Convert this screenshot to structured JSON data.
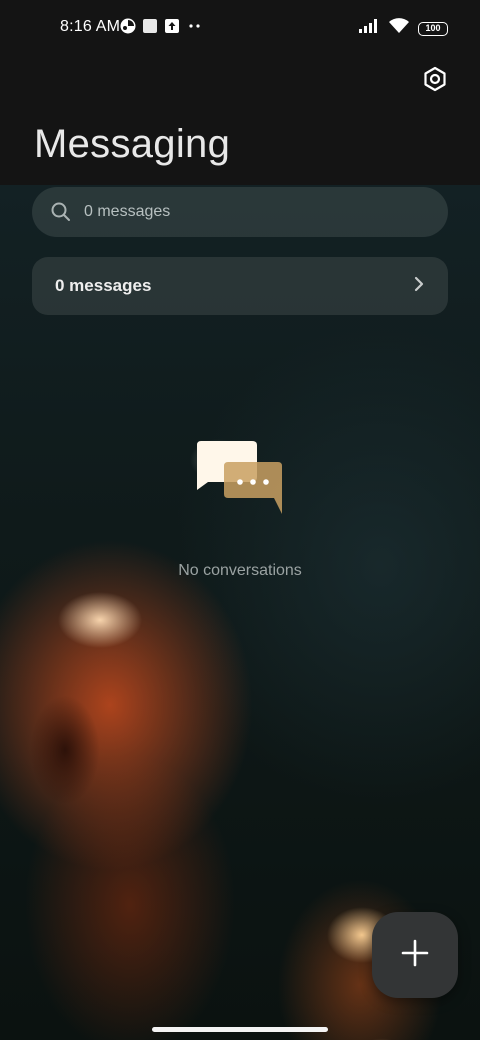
{
  "status_bar": {
    "time": "8:16 AM",
    "battery_level": "100",
    "icons_left": [
      "pinwheel-icon",
      "square-notification-icon",
      "upload-icon",
      "more-dots-icon"
    ],
    "icons_right": [
      "signal-icon",
      "wifi-icon",
      "battery-icon"
    ]
  },
  "header": {
    "title": "Messaging",
    "settings_icon": "settings-hexagon-icon"
  },
  "search": {
    "placeholder": "0 messages",
    "icon": "search-icon"
  },
  "messages_card": {
    "label": "0 messages",
    "icon": "chevron-right-icon"
  },
  "empty_state": {
    "icon": "chat-bubbles-icon",
    "text": "No conversations"
  },
  "fab": {
    "icon": "plus-icon"
  },
  "colors": {
    "header_bg": "#141414",
    "fab_bg": "#333536",
    "accent_bubble": "#fff7ea",
    "secondary_bubble": "#c9a062"
  }
}
